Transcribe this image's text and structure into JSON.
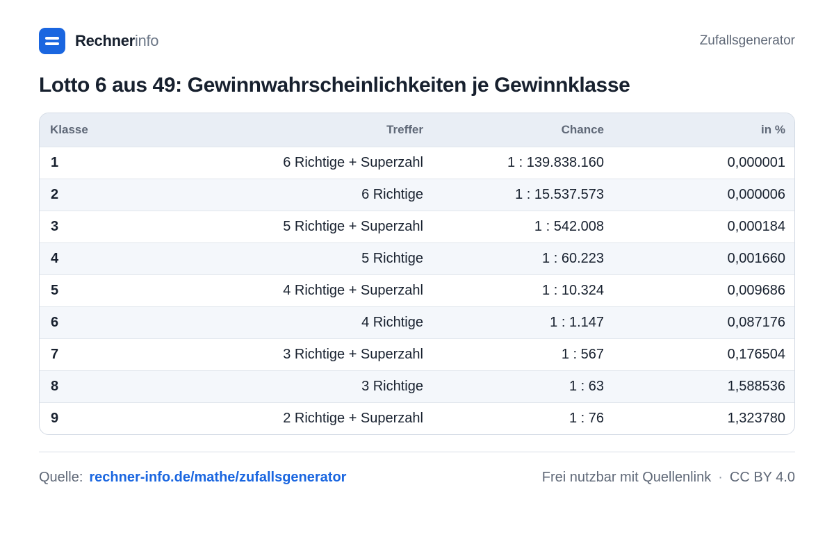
{
  "header": {
    "brand_strong": "Rechner",
    "brand_light": "info",
    "nav_link": "Zufallsgenerator"
  },
  "title": "Lotto 6 aus 49: Gewinnwahrscheinlichkeiten je Gewinnklasse",
  "table": {
    "columns": [
      "Klasse",
      "Treffer",
      "Chance",
      "in %"
    ],
    "rows": [
      {
        "klasse": "1",
        "treffer": "6 Richtige + Superzahl",
        "chance": "1 : 139.838.160",
        "prozent": "0,000001"
      },
      {
        "klasse": "2",
        "treffer": "6 Richtige",
        "chance": "1 : 15.537.573",
        "prozent": "0,000006"
      },
      {
        "klasse": "3",
        "treffer": "5 Richtige + Superzahl",
        "chance": "1 : 542.008",
        "prozent": "0,000184"
      },
      {
        "klasse": "4",
        "treffer": "5 Richtige",
        "chance": "1 : 60.223",
        "prozent": "0,001660"
      },
      {
        "klasse": "5",
        "treffer": "4 Richtige + Superzahl",
        "chance": "1 : 10.324",
        "prozent": "0,009686"
      },
      {
        "klasse": "6",
        "treffer": "4 Richtige",
        "chance": "1 : 1.147",
        "prozent": "0,087176"
      },
      {
        "klasse": "7",
        "treffer": "3 Richtige + Superzahl",
        "chance": "1 : 567",
        "prozent": "0,176504"
      },
      {
        "klasse": "8",
        "treffer": "3 Richtige",
        "chance": "1 : 63",
        "prozent": "1,588536"
      },
      {
        "klasse": "9",
        "treffer": "2 Richtige + Superzahl",
        "chance": "1 : 76",
        "prozent": "1,323780"
      }
    ]
  },
  "footer": {
    "source_label": "Quelle:",
    "source_link": "rechner-info.de/mathe/zufallsgenerator",
    "license_text": "Frei nutzbar mit Quellenlink",
    "separator": "·",
    "license": "CC BY 4.0"
  },
  "colors": {
    "accent": "#1a66e0",
    "text": "#17202e",
    "muted": "#5f6877",
    "header_bg": "#e9eef5",
    "zebra_bg": "#f4f7fb"
  },
  "icons": {
    "logo": "rechnerinfo-logo-icon"
  }
}
